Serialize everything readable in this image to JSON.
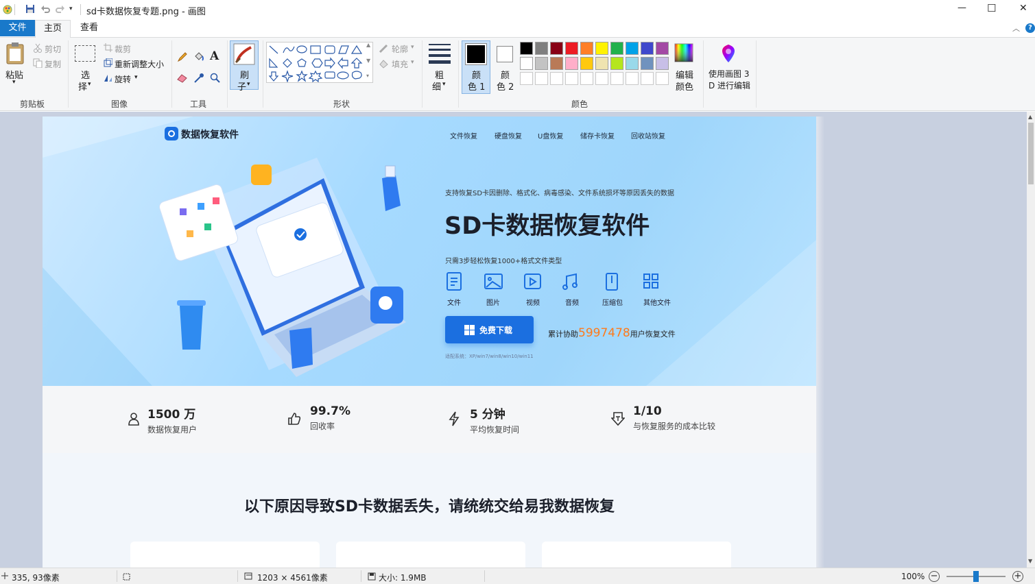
{
  "titlebar": {
    "title": "sd卡数据恢复专题.png - 画图",
    "minimize": "—",
    "maximize": "☐",
    "close": "✕"
  },
  "tabs": [
    {
      "label": "文件"
    },
    {
      "label": "主页"
    },
    {
      "label": "查看"
    }
  ],
  "ribbon": {
    "clipboard": {
      "paste": "粘贴",
      "cut": "剪切",
      "copy": "复制",
      "group": "剪贴板"
    },
    "image": {
      "select": "选",
      "select2": "择",
      "crop": "裁剪",
      "resize": "重新调整大小",
      "rotate": "旋转",
      "group": "图像"
    },
    "tools": {
      "group": "工具"
    },
    "brush": {
      "label": "刷",
      "label2": "子"
    },
    "shapes": {
      "outline": "轮廓",
      "fill": "填充",
      "group": "形状"
    },
    "size": {
      "label": "粗",
      "label2": "细"
    },
    "color1": {
      "label": "颜",
      "label2": "色 1"
    },
    "color2": {
      "label": "颜",
      "label2": "色 2"
    },
    "colors": {
      "group": "颜色",
      "edit": "编辑",
      "edit2": "颜色"
    },
    "paint3d": {
      "label": "使用画图 3",
      "label2": "D 进行编辑"
    },
    "palette_row1": [
      "#000000",
      "#7f7f7f",
      "#880015",
      "#ed1c24",
      "#ff7f27",
      "#fff200",
      "#22b14c",
      "#00a2e8",
      "#3f48cc",
      "#a349a4"
    ],
    "palette_row2": [
      "#ffffff",
      "#c3c3c3",
      "#b97a57",
      "#ffaec9",
      "#ffc90e",
      "#efe4b0",
      "#b5e61d",
      "#99d9ea",
      "#7092be",
      "#c8bfe7"
    ]
  },
  "page": {
    "logo_text": "数据恢复软件",
    "nav": [
      "文件恢复",
      "硬盘恢复",
      "U盘恢复",
      "储存卡恢复",
      "回收站恢复"
    ],
    "illustration_badge": "恢复成功",
    "subtitle": "支持恢复SD卡因删除、格式化、病毒感染、文件系统损坏等原因丢失的数据",
    "headline": "SD卡数据恢复软件",
    "steps": "只需3步轻松恢复1000+格式文件类型",
    "filetypes": [
      "文件",
      "图片",
      "视频",
      "音频",
      "压缩包",
      "其他文件"
    ],
    "download": "免费下载",
    "counter_prefix": "累计协助",
    "counter_value": "5997478",
    "counter_suffix": "用户恢复文件",
    "compat": "适配系统：XP/win7/win8/win10/win11",
    "stats": [
      {
        "value": "1500 万",
        "desc": "数据恢复用户"
      },
      {
        "value": "99.7%",
        "desc": "回收率"
      },
      {
        "value": "5 分钟",
        "desc": "平均恢复时间"
      },
      {
        "value": "1/10",
        "desc": "与恢复服务的成本比较"
      }
    ],
    "section_title": "以下原因导致SD卡数据丢失，请统统交给易我数据恢复"
  },
  "status": {
    "cursor": "335, 93像素",
    "dimensions": "1203 × 4561像素",
    "filesize": "大小: 1.9MB",
    "zoom": "100%",
    "zoom_level": 0.5
  }
}
